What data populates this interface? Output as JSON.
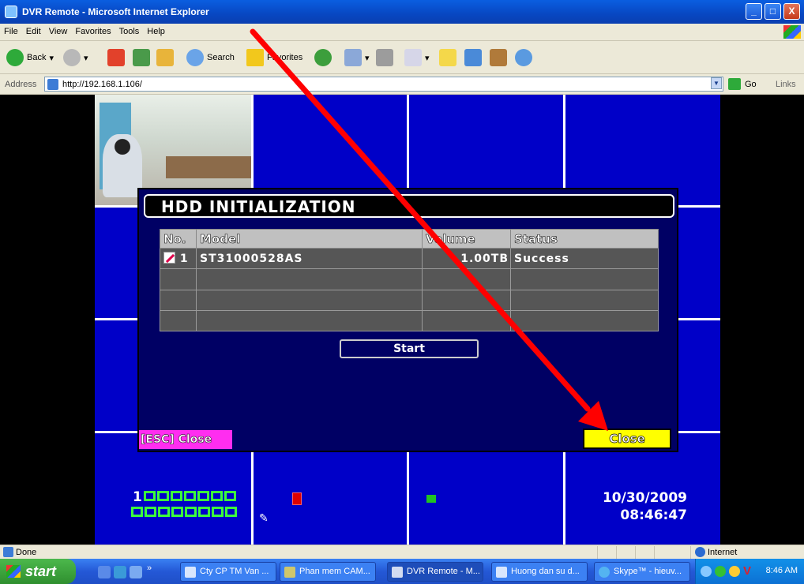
{
  "window": {
    "title": "DVR Remote - Microsoft Internet Explorer",
    "controls": [
      "_",
      "□",
      "X"
    ]
  },
  "menu": [
    "File",
    "Edit",
    "View",
    "Favorites",
    "Tools",
    "Help"
  ],
  "toolbar": {
    "back_label": "Back",
    "search_label": "Search",
    "favorites_label": "Favorites"
  },
  "address": {
    "label": "Address",
    "url": "http://192.168.1.106/",
    "go_label": "Go",
    "links_label": "Links"
  },
  "dvr": {
    "dialog_title": "HDD INITIALIZATION",
    "table": {
      "headers": [
        "No.",
        "Model",
        "Volume",
        "Status"
      ],
      "rows": [
        {
          "no": "1",
          "model": "ST31000528AS",
          "volume": "1.00TB",
          "status": "Success",
          "checked": true
        },
        {
          "no": "",
          "model": "",
          "volume": "",
          "status": ""
        },
        {
          "no": "",
          "model": "",
          "volume": "",
          "status": ""
        },
        {
          "no": "",
          "model": "",
          "volume": "",
          "status": ""
        }
      ]
    },
    "start_label": "Start",
    "esc_close_label": "[ESC] Close",
    "close_label": "Close",
    "channel_number": "1",
    "date": "10/30/2009",
    "time": "08:46:47"
  },
  "status": {
    "left": "Done",
    "zone": "Internet"
  },
  "taskbar": {
    "start_label": "start",
    "tasks": [
      "Cty CP TM Van ...",
      "Phan mem CAM...",
      "DVR Remote - M...",
      "Huong dan su d...",
      "Skype™ - hieuv..."
    ],
    "clock": "8:46 AM"
  },
  "colors": {
    "dvr_blue": "#0000c8",
    "dialog_blue": "#000064",
    "close_yellow": "#ffff00",
    "esc_magenta": "#ff2df0",
    "channel_green": "#3cff3c",
    "arrow_red": "#ff0000"
  }
}
